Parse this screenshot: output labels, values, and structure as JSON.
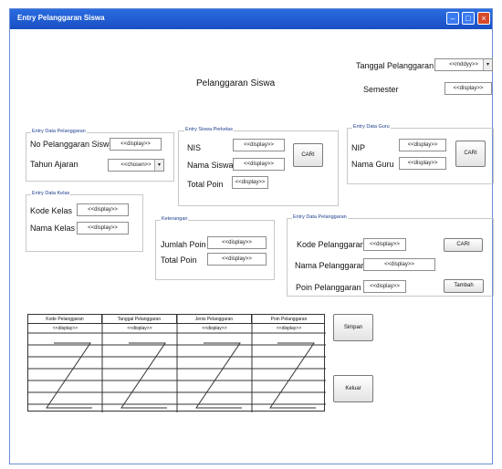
{
  "window": {
    "title": "Entry Pelanggaran Siswa"
  },
  "header": {
    "page_title": "Pelanggaran Siswa",
    "tanggal_label": "Tanggal Pelanggaran",
    "tanggal_value": "<<mddyy>>",
    "semester_label": "Semester",
    "semester_value": "<<display>>"
  },
  "group_pelanggaran": {
    "legend": "Entry Data Pelanggaran",
    "no_label": "No Pelanggaran Siswa",
    "no_value": "<<display>>",
    "tahun_label": "Tahun Ajaran",
    "tahun_value": "<<chosen>>"
  },
  "group_siswa": {
    "legend": "Entry Siswa Perkelas",
    "nis_label": "NIS",
    "nis_value": "<<display>>",
    "nama_label": "Nama Siswa",
    "nama_value": "<<display>>",
    "poin_label": "Total Poin",
    "poin_value": "<<display>>",
    "cari_label": "CARI"
  },
  "group_guru": {
    "legend": "Entry Data Guru",
    "nip_label": "NIP",
    "nip_value": "<<display>>",
    "nama_label": "Nama Guru",
    "nama_value": "<<display>>",
    "cari_label": "CARI"
  },
  "group_kelas": {
    "legend": "Entry Data Kelas",
    "kode_label": "Kode Kelas",
    "kode_value": "<<display>>",
    "nama_label": "Nama Kelas",
    "nama_value": "<<display>>"
  },
  "group_keterangan": {
    "legend": "Keterangan",
    "jumlah_label": "Jumlah Poin",
    "jumlah_value": "<<display>>",
    "total_label": "Total Poin",
    "total_value": "<<display>>"
  },
  "group_data_pelanggaran": {
    "legend": "Entry Data Pelanggaran",
    "kode_label": "Kode Pelanggaran",
    "kode_value": "<<display>>",
    "nama_label": "Nama Pelanggaran",
    "nama_value": "<<display>>",
    "poin_label": "Poin Pelanggaran",
    "poin_value": "<<display>>",
    "cari_label": "CARI",
    "tambah_label": "Tambah"
  },
  "table": {
    "columns": [
      "Kode Pelanggaran",
      "Tanggal Pelanggaran",
      "Jenis Pelanggaran",
      "Poin Pelanggaran"
    ],
    "row_values": [
      "<<display>>",
      "<<display>>",
      "<<display>>",
      "<<display>>"
    ]
  },
  "actions": {
    "simpan_label": "Simpan",
    "keluar_label": "Keluar"
  }
}
